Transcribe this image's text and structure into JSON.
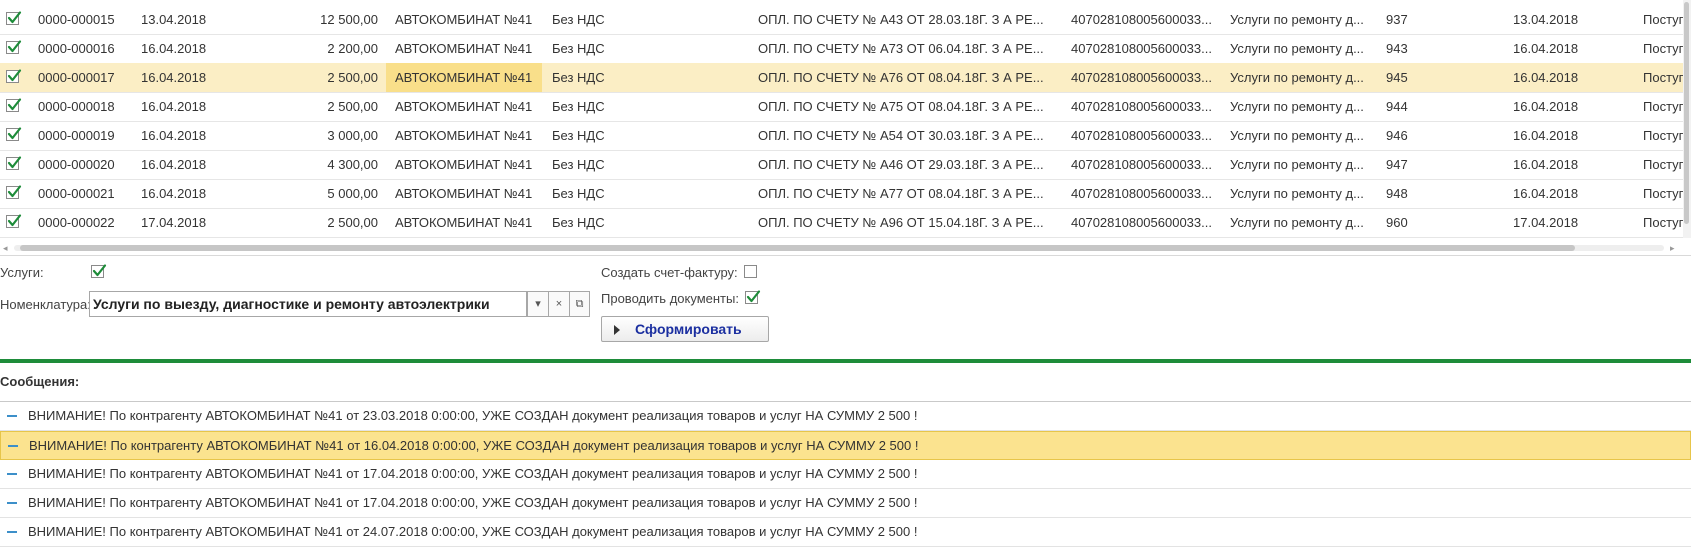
{
  "table": {
    "rows": [
      {
        "checked": true,
        "number": "0000-000015",
        "date": "13.04.2018",
        "amount": "12 500,00",
        "counterparty": "АВТОКОМБИНАТ №41",
        "vat": "Без НДС",
        "purpose": "ОПЛ. ПО СЧЕТУ № А43 ОТ 28.03.18Г. З А РЕ...",
        "account": "407028108005600033...",
        "service": "Услуги по ремонту д...",
        "doc_no": "937",
        "doc_date": "13.04.2018",
        "type": "Поступ"
      },
      {
        "checked": true,
        "number": "0000-000016",
        "date": "16.04.2018",
        "amount": "2 200,00",
        "counterparty": "АВТОКОМБИНАТ №41",
        "vat": "Без НДС",
        "purpose": "ОПЛ. ПО СЧЕТУ № А73 ОТ 06.04.18Г. З А РЕ...",
        "account": "407028108005600033...",
        "service": "Услуги по ремонту д...",
        "doc_no": "943",
        "doc_date": "16.04.2018",
        "type": "Поступ"
      },
      {
        "checked": true,
        "number": "0000-000017",
        "date": "16.04.2018",
        "amount": "2 500,00",
        "counterparty": "АВТОКОМБИНАТ №41",
        "vat": "Без НДС",
        "purpose": "ОПЛ. ПО СЧЕТУ № А76 ОТ 08.04.18Г. З А РЕ...",
        "account": "407028108005600033...",
        "service": "Услуги по ремонту д...",
        "doc_no": "945",
        "doc_date": "16.04.2018",
        "type": "Поступ",
        "selected": true
      },
      {
        "checked": true,
        "number": "0000-000018",
        "date": "16.04.2018",
        "amount": "2 500,00",
        "counterparty": "АВТОКОМБИНАТ №41",
        "vat": "Без НДС",
        "purpose": "ОПЛ. ПО СЧЕТУ № А75 ОТ 08.04.18Г. З А РЕ...",
        "account": "407028108005600033...",
        "service": "Услуги по ремонту д...",
        "doc_no": "944",
        "doc_date": "16.04.2018",
        "type": "Поступ"
      },
      {
        "checked": true,
        "number": "0000-000019",
        "date": "16.04.2018",
        "amount": "3 000,00",
        "counterparty": "АВТОКОМБИНАТ №41",
        "vat": "Без НДС",
        "purpose": "ОПЛ. ПО СЧЕТУ № А54 ОТ 30.03.18Г. З А РЕ...",
        "account": "407028108005600033...",
        "service": "Услуги по ремонту д...",
        "doc_no": "946",
        "doc_date": "16.04.2018",
        "type": "Поступ"
      },
      {
        "checked": true,
        "number": "0000-000020",
        "date": "16.04.2018",
        "amount": "4 300,00",
        "counterparty": "АВТОКОМБИНАТ №41",
        "vat": "Без НДС",
        "purpose": "ОПЛ. ПО СЧЕТУ № А46 ОТ 29.03.18Г. З А РЕ...",
        "account": "407028108005600033...",
        "service": "Услуги по ремонту д...",
        "doc_no": "947",
        "doc_date": "16.04.2018",
        "type": "Поступ"
      },
      {
        "checked": true,
        "number": "0000-000021",
        "date": "16.04.2018",
        "amount": "5 000,00",
        "counterparty": "АВТОКОМБИНАТ №41",
        "vat": "Без НДС",
        "purpose": "ОПЛ. ПО СЧЕТУ № А77 ОТ 08.04.18Г. З А РЕ...",
        "account": "407028108005600033...",
        "service": "Услуги по ремонту д...",
        "doc_no": "948",
        "doc_date": "16.04.2018",
        "type": "Поступ"
      },
      {
        "checked": true,
        "number": "0000-000022",
        "date": "17.04.2018",
        "amount": "2 500,00",
        "counterparty": "АВТОКОМБИНАТ №41",
        "vat": "Без НДС",
        "purpose": "ОПЛ. ПО СЧЕТУ № А96 ОТ 15.04.18Г. З А РЕ...",
        "account": "407028108005600033...",
        "service": "Услуги по ремонту д...",
        "doc_no": "960",
        "doc_date": "17.04.2018",
        "type": "Поступ"
      }
    ]
  },
  "form": {
    "services_label": "Услуги:",
    "services_checked": true,
    "nomenclature_label": "Номенклатура:",
    "nomenclature_value": "Услуги по выезду, диагностике и ремонту автоэлектрики",
    "create_invoice_label": "Создать счет-фактуру:",
    "create_invoice_checked": false,
    "post_documents_label": "Проводить документы:",
    "post_documents_checked": true,
    "generate_button": "Сформировать",
    "dropdown_glyph": "▾",
    "clear_glyph": "×",
    "open_glyph": "⧉"
  },
  "messages": {
    "header": "Сообщения:",
    "items": [
      {
        "text": "ВНИМАНИЕ! По контрагенту АВТОКОМБИНАТ №41 от 23.03.2018 0:00:00, УЖЕ СОЗДАН документ реализация товаров и услуг НА СУММУ 2 500 !"
      },
      {
        "text": "ВНИМАНИЕ! По контрагенту АВТОКОМБИНАТ №41 от 16.04.2018 0:00:00, УЖЕ СОЗДАН документ реализация товаров и услуг НА СУММУ 2 500 !",
        "selected": true
      },
      {
        "text": "ВНИМАНИЕ! По контрагенту АВТОКОМБИНАТ №41 от 17.04.2018 0:00:00, УЖЕ СОЗДАН документ реализация товаров и услуг НА СУММУ 2 500 !"
      },
      {
        "text": "ВНИМАНИЕ! По контрагенту АВТОКОМБИНАТ №41 от 17.04.2018 0:00:00, УЖЕ СОЗДАН документ реализация товаров и услуг НА СУММУ 2 500 !"
      },
      {
        "text": "ВНИМАНИЕ! По контрагенту АВТОКОМБИНАТ №41 от 24.07.2018 0:00:00, УЖЕ СОЗДАН документ реализация товаров и услуг НА СУММУ 2 500 !"
      }
    ]
  },
  "colors": {
    "selected_row": "#fbeec5",
    "selected_cell": "#f9df8a",
    "check_green": "#1e8c3a",
    "separator_green": "#1e8c3a",
    "message_selected": "#fbe38f",
    "button_text": "#1b2fa0"
  },
  "icons": {
    "row_checkbox": "checkmark-icon",
    "message_marker": "dash-icon",
    "button_marker": "play-triangle-icon"
  }
}
